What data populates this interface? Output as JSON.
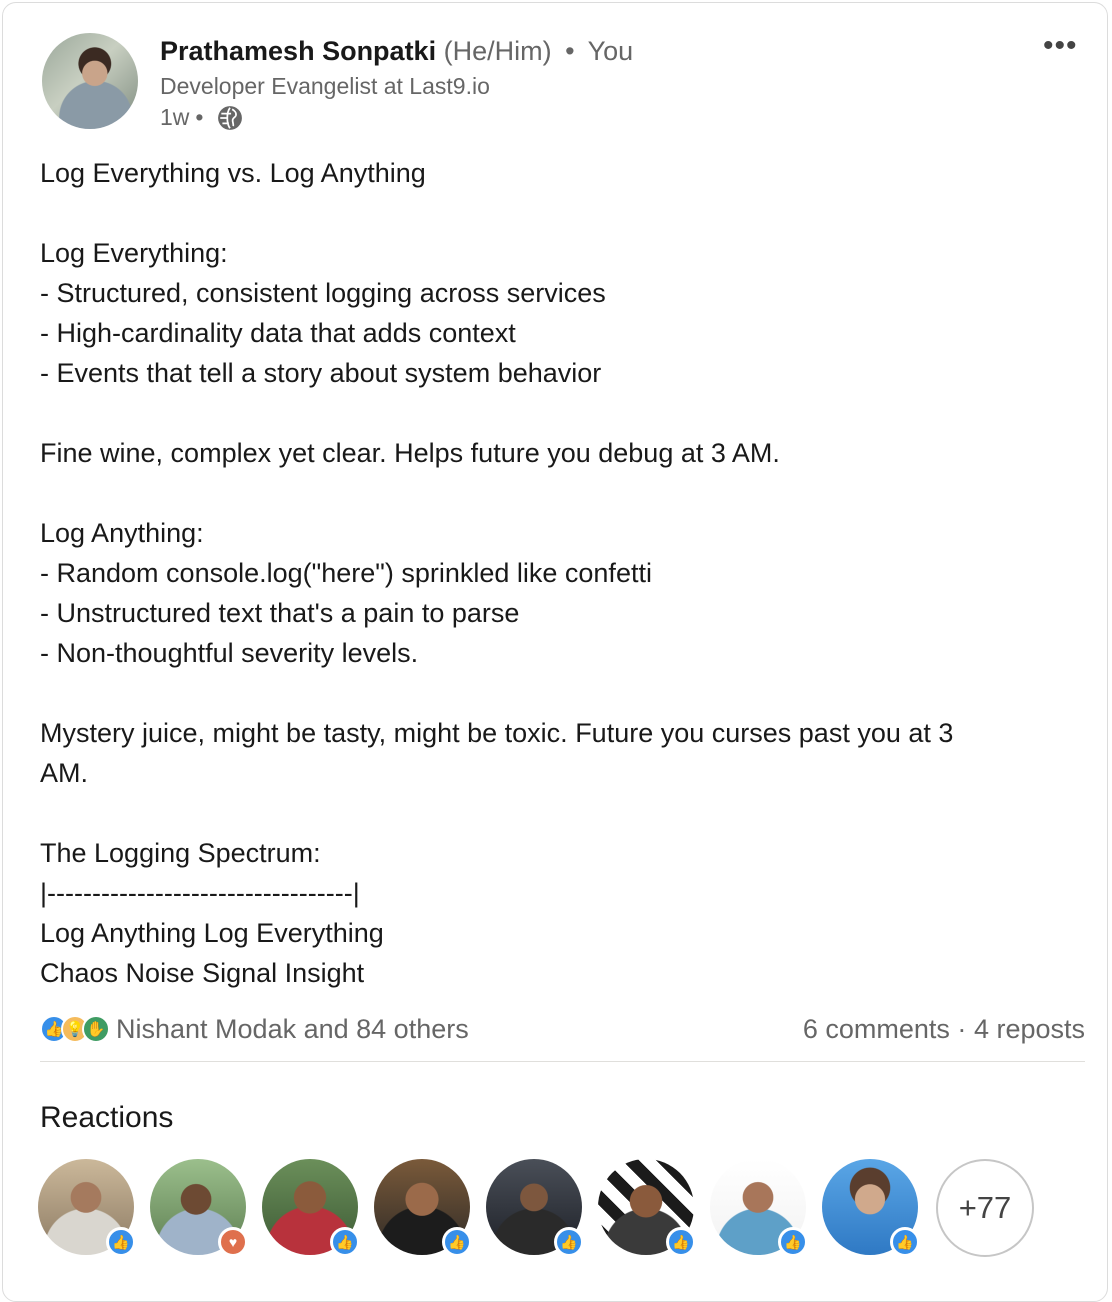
{
  "author": {
    "name": "Prathamesh Sonpatki",
    "pronouns": "(He/Him)",
    "relation": "You",
    "headline": "Developer Evangelist at Last9.io",
    "time": "1w",
    "visibility_icon": "globe-icon"
  },
  "more_icon": "•••",
  "post": {
    "lines": [
      "Log Everything vs. Log Anything",
      "",
      "Log Everything:",
      "- Structured, consistent logging across services",
      "- High-cardinality data that adds context",
      "- Events that tell a story about system behavior",
      "",
      "Fine wine, complex yet clear. Helps future you debug at 3 AM.",
      "",
      "Log Anything:",
      "- Random console.log(\"here\") sprinkled like confetti",
      "- Unstructured text that's a pain to parse",
      "- Non-thoughtful severity levels.",
      "",
      "Mystery juice, might be tasty, might be toxic. Future you curses past you at 3",
      "AM.",
      "",
      "The Logging Spectrum:",
      "|----------------------------------|",
      "Log Anything Log Everything",
      "Chaos Noise Signal Insight"
    ]
  },
  "social": {
    "reaction_types": [
      "like",
      "insightful",
      "support"
    ],
    "reactors_text": "Nishant Modak and 84 others",
    "comments": "6 comments",
    "separator": "·",
    "reposts": "4 reposts"
  },
  "reactions": {
    "title": "Reactions",
    "people": [
      {
        "reaction": "like"
      },
      {
        "reaction": "love"
      },
      {
        "reaction": "like"
      },
      {
        "reaction": "like"
      },
      {
        "reaction": "like"
      },
      {
        "reaction": "like"
      },
      {
        "reaction": "like"
      },
      {
        "reaction": "like"
      }
    ],
    "more_count": "+77"
  },
  "colors": {
    "like": "#378fe9",
    "love": "#df704d",
    "insightful": "#f5bb5c",
    "support": "#3f9c63",
    "secondary_text": "#666666"
  }
}
